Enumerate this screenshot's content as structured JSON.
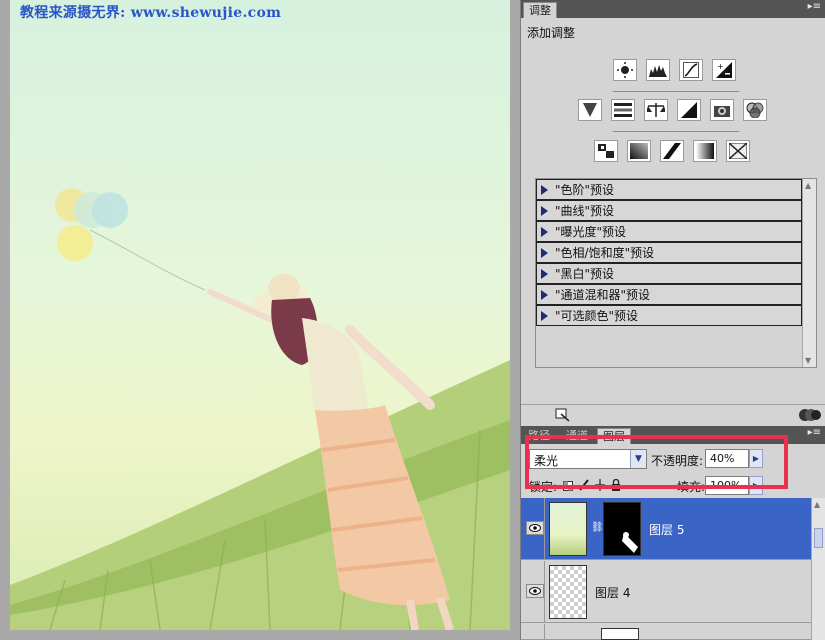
{
  "canvas": {
    "watermark": "教程来源摄无界: www.shewujie.com"
  },
  "adjustments": {
    "tab_label": "调整",
    "title": "添加调整",
    "row1_icons": [
      "brightness-contrast-icon",
      "levels-icon",
      "curves-icon",
      "exposure-icon"
    ],
    "row2_icons": [
      "vibrance-icon",
      "hue-saturation-icon",
      "color-balance-icon",
      "black-white-icon",
      "photo-filter-icon",
      "channel-mixer-icon"
    ],
    "row3_icons": [
      "invert-icon",
      "posterize-icon",
      "threshold-icon",
      "gradient-map-icon",
      "selective-color-icon"
    ],
    "presets": [
      "\"色阶\"预设",
      "\"曲线\"预设",
      "\"曝光度\"预设",
      "\"色相/饱和度\"预设",
      "\"黑白\"预设",
      "\"通道混和器\"预设",
      "\"可选颜色\"预设"
    ]
  },
  "layers_panel": {
    "tabs": [
      "路径",
      "通道",
      "图层"
    ],
    "blend_mode": "柔光",
    "opacity_label": "不透明度:",
    "opacity_value": "40%",
    "lock_label": "锁定:",
    "fill_label": "填充:",
    "fill_value": "100%",
    "layers": [
      {
        "name": "图层 5",
        "selected": true
      },
      {
        "name": "图层 4",
        "selected": false
      }
    ]
  },
  "colors": {
    "selected_layer": "#3a64c6",
    "highlight_box": "#e8314f",
    "watermark": "#2a55c8"
  }
}
